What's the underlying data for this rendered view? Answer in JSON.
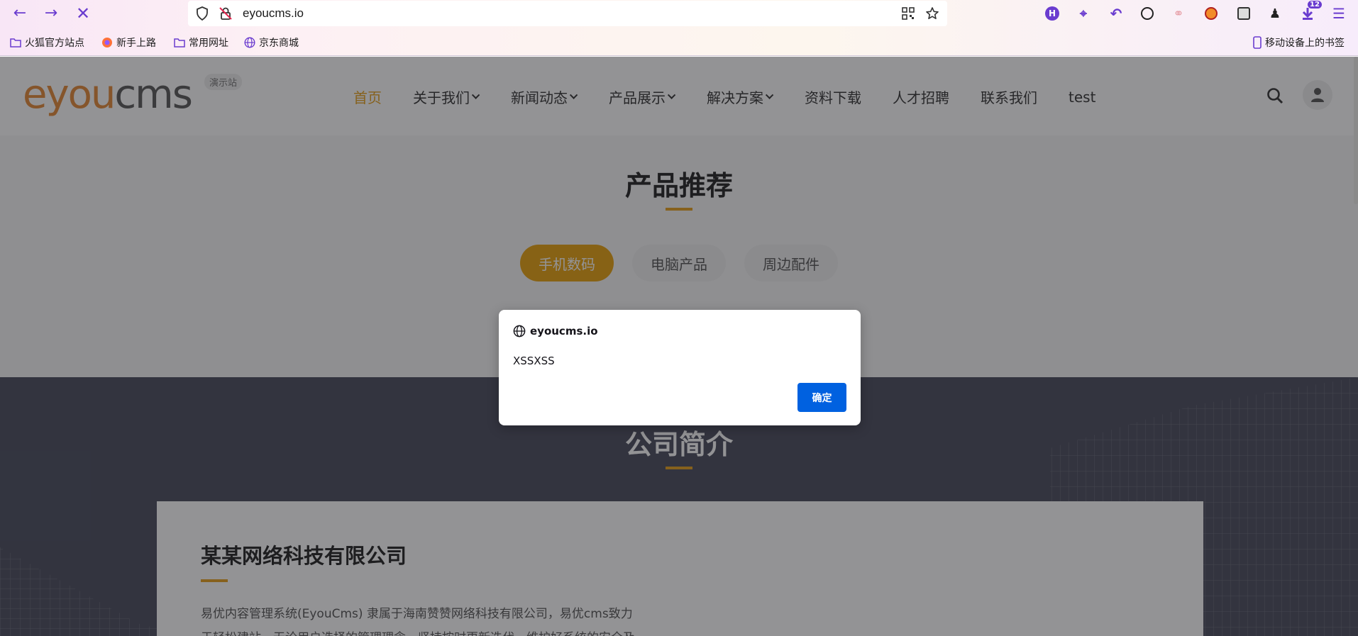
{
  "browser": {
    "url": "eyoucms.io",
    "bookmarks": [
      "火狐官方站点",
      "新手上路",
      "常用网址",
      "京东商城"
    ],
    "mobile_bookmarks": "移动设备上的书签",
    "download_count": "12",
    "accent_color": "#6a3ccf"
  },
  "site": {
    "logo": {
      "e": "e",
      "you": "you",
      "cms": "cms"
    },
    "demo_badge": "演示站",
    "nav": [
      {
        "label": "首页",
        "active": true
      },
      {
        "label": "关于我们",
        "dropdown": true
      },
      {
        "label": "新闻动态",
        "dropdown": true
      },
      {
        "label": "产品展示",
        "dropdown": true
      },
      {
        "label": "解决方案",
        "dropdown": true
      },
      {
        "label": "资料下载"
      },
      {
        "label": "人才招聘"
      },
      {
        "label": "联系我们"
      },
      {
        "label": "test"
      }
    ],
    "products": {
      "title": "产品推荐",
      "tabs": [
        "手机数码",
        "电脑产品",
        "周边配件"
      ]
    },
    "company": {
      "title": "公司简介",
      "name": "某某网络科技有限公司",
      "desc": "易优内容管理系统(EyouCms) 隶属于海南赞赞网络科技有限公司，易优cms致力于轻松建站，无论用户选择的管理理念，坚持按时更新迭代，维护好系统的安全及"
    },
    "brand_color": "#e6a01d"
  },
  "dialog": {
    "origin": "eyoucms.io",
    "message": "XSSXSS",
    "ok_label": "确定"
  }
}
